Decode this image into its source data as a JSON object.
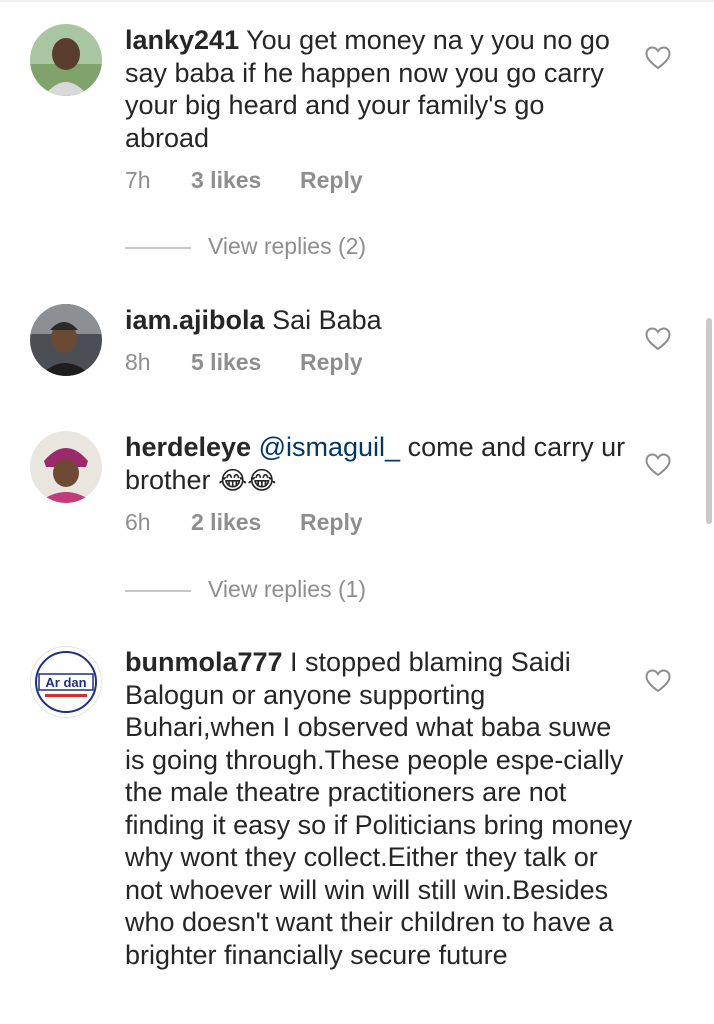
{
  "comments": [
    {
      "username": "lanky241",
      "text": " You get money na y you no go say baba if he happen now you go carry your big heard and your family's go abroad",
      "time": "7h",
      "likes": "3 likes",
      "reply": "Reply",
      "view_replies": "View replies (2)"
    },
    {
      "username": "iam.ajibola",
      "text": " Sai Baba",
      "time": "8h",
      "likes": "5 likes",
      "reply": "Reply"
    },
    {
      "username": "herdeleye",
      "mention": "@ismaguil_",
      "text": " come and carry ur brother ",
      "emoji": "😂😂",
      "time": "6h",
      "likes": "2 likes",
      "reply": "Reply",
      "view_replies": "View replies (1)"
    },
    {
      "username": "bunmola777",
      "text": " I stopped blaming Saidi Balogun or anyone supporting Buhari,when I observed what baba suwe is going through.These people espe-cially the male theatre practitioners are not finding it easy so if Politicians bring money why wont they collect.Either they talk or not whoever will win will still win.Besides who doesn't want their children to have a brighter financially secure future",
      "avatar_logo_text": "Ar dan"
    }
  ],
  "icons": {
    "like": "heart-outline-icon"
  },
  "colors": {
    "text": "#262626",
    "meta": "#8e8e8e",
    "mention": "#00376b",
    "divider": "#c7c7c7"
  }
}
